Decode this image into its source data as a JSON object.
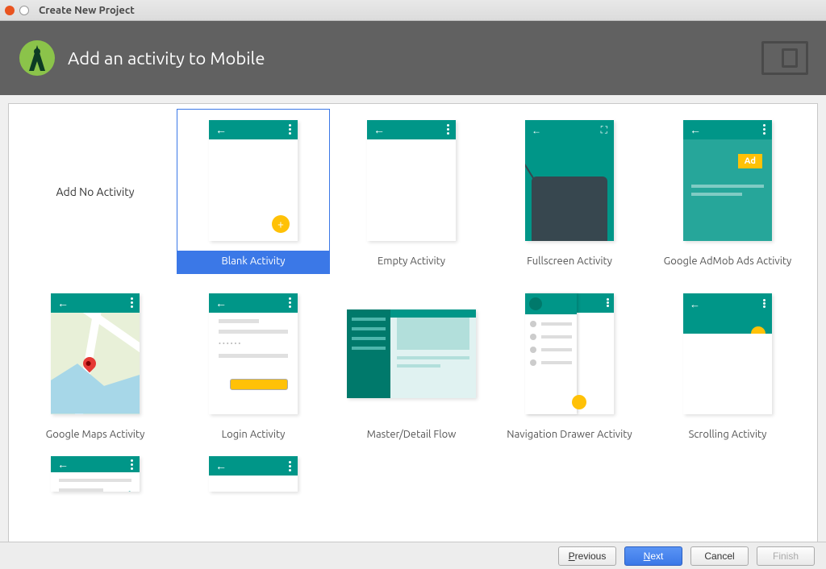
{
  "window": {
    "title": "Create New Project"
  },
  "header": {
    "title": "Add an activity to Mobile"
  },
  "selected_index": 1,
  "templates": [
    {
      "label": "Add No Activity",
      "kind": "none"
    },
    {
      "label": "Blank Activity",
      "kind": "blank"
    },
    {
      "label": "Empty Activity",
      "kind": "empty"
    },
    {
      "label": "Fullscreen Activity",
      "kind": "fullscreen"
    },
    {
      "label": "Google AdMob Ads Activity",
      "kind": "admob"
    },
    {
      "label": "Google Maps Activity",
      "kind": "maps"
    },
    {
      "label": "Login Activity",
      "kind": "login"
    },
    {
      "label": "Master/Detail Flow",
      "kind": "masterdetail"
    },
    {
      "label": "Navigation Drawer Activity",
      "kind": "navdrawer"
    },
    {
      "label": "Scrolling Activity",
      "kind": "scrolling"
    },
    {
      "label": "",
      "kind": "settings_partial"
    },
    {
      "label": "",
      "kind": "tabbed_partial"
    }
  ],
  "footer": {
    "previous": "Previous",
    "next": "Next",
    "cancel": "Cancel",
    "finish": "Finish"
  },
  "admob_badge": "Ad"
}
